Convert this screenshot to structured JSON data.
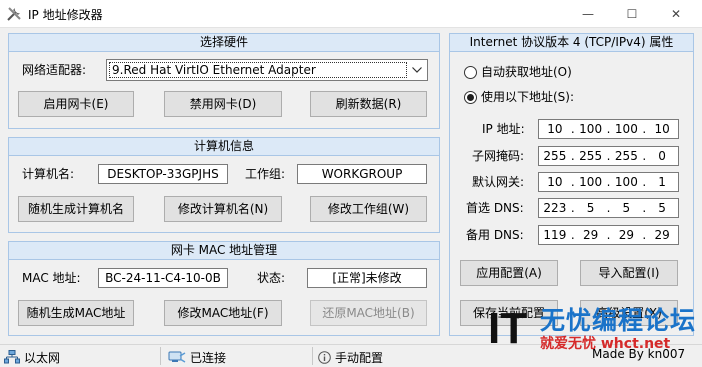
{
  "window": {
    "title": "IP 地址修改器",
    "min_glyph": "—",
    "max_glyph": "☐",
    "close_glyph": "✕",
    "icon": "tools-icon"
  },
  "hardware": {
    "header": "选择硬件",
    "adapter_label": "网络适配器:",
    "adapter_value": "9.Red Hat VirtIO Ethernet Adapter",
    "enable_button": "启用网卡(E)",
    "disable_button": "禁用网卡(D)",
    "refresh_button": "刷新数据(R)"
  },
  "computer": {
    "header": "计算机信息",
    "name_label": "计算机名:",
    "name_value": "DESKTOP-33GPJHS",
    "workgroup_label": "工作组:",
    "workgroup_value": "WORKGROUP",
    "random_name_button": "随机生成计算机名",
    "change_name_button": "修改计算机名(N)",
    "change_workgroup_button": "修改工作组(W)"
  },
  "mac": {
    "header": "网卡 MAC 地址管理",
    "mac_label": "MAC 地址:",
    "mac_value": "BC-24-11-C4-10-0B",
    "status_label": "状态:",
    "status_value": "[正常]未修改",
    "random_mac_button": "随机生成MAC地址",
    "change_mac_button": "修改MAC地址(F)",
    "restore_mac_button": "还原MAC地址(B)"
  },
  "ipv4": {
    "header": "Internet 协议版本 4 (TCP/IPv4) 属性",
    "auto_label": "自动获取地址(O)",
    "manual_label": "使用以下地址(S):",
    "selected": "manual",
    "ip_label": "IP 地址:",
    "ip": [
      "10",
      "100",
      "100",
      "10"
    ],
    "mask_label": "子网掩码:",
    "mask": [
      "255",
      "255",
      "255",
      "0"
    ],
    "gateway_label": "默认网关:",
    "gateway": [
      "10",
      "100",
      "100",
      "1"
    ],
    "dns1_label": "首选 DNS:",
    "dns1": [
      "223",
      "5",
      "5",
      "5"
    ],
    "dns2_label": "备用 DNS:",
    "dns2": [
      "119",
      "29",
      "29",
      "29"
    ],
    "apply_button": "应用配置(A)",
    "import_button": "导入配置(I)",
    "save_button": "保存当前配置",
    "other_button": "高级设置(X)"
  },
  "statusbar": {
    "network_type": "以太网",
    "connection": "已连接",
    "mode": "手动配置"
  },
  "watermark": {
    "logo_text": "IT",
    "title": "无忧编程论坛",
    "subtitle": "就爱无忧 whct.net",
    "credit": "Made By kn007"
  },
  "colors": {
    "group_border": "#a9c6e6",
    "group_header_bg": "#dce9f7",
    "watermark_blue": "#1a73c9",
    "watermark_red": "#d52a2a"
  }
}
